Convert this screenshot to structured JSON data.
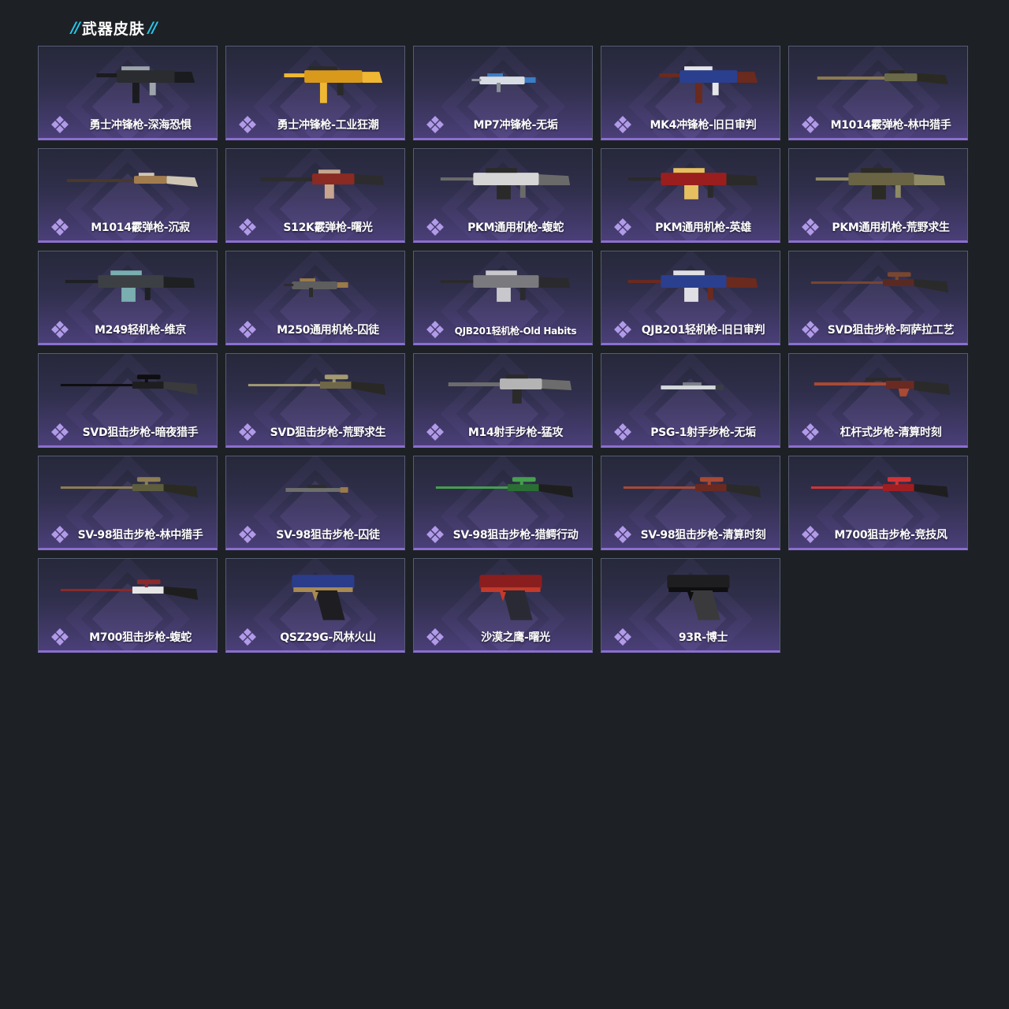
{
  "header": {
    "title": "武器皮肤",
    "slash": "//"
  },
  "skins": [
    {
      "name": "勇士冲锋枪-深海恐惧",
      "kind": "smg",
      "colors": [
        "#2a2c30",
        "#9ea4ab",
        "#1a1b1e"
      ]
    },
    {
      "name": "勇士冲锋枪-工业狂潮",
      "kind": "smg",
      "colors": [
        "#d99a1c",
        "#2a2a2a",
        "#f0b832"
      ]
    },
    {
      "name": "MP7冲锋枪-无垢",
      "kind": "compact",
      "colors": [
        "#d8dde4",
        "#3a7fc6",
        "#8a9098"
      ]
    },
    {
      "name": "MK4冲锋枪-旧日审判",
      "kind": "smg",
      "colors": [
        "#2a3f8e",
        "#e6e6ea",
        "#6a2a1e"
      ]
    },
    {
      "name": "M1014霰弹枪-林中猎手",
      "kind": "long",
      "colors": [
        "#6a6a48",
        "#2a2a22",
        "#8b7b52"
      ]
    },
    {
      "name": "M1014霰弹枪-沉寂",
      "kind": "long",
      "colors": [
        "#a37c4e",
        "#cfc7b4",
        "#4a3828"
      ]
    },
    {
      "name": "S12K霰弹枪-曙光",
      "kind": "rifle",
      "colors": [
        "#8a2a22",
        "#c7a58e",
        "#2c2c2e"
      ]
    },
    {
      "name": "PKM通用机枪-蝮蛇",
      "kind": "mg",
      "colors": [
        "#d6d6d6",
        "#2a2a2a",
        "#6a6a6a"
      ]
    },
    {
      "name": "PKM通用机枪-英雄",
      "kind": "mg",
      "colors": [
        "#9a1e1e",
        "#e6c060",
        "#2a2a2a"
      ]
    },
    {
      "name": "PKM通用机枪-荒野求生",
      "kind": "mg",
      "colors": [
        "#6a6444",
        "#2c2a24",
        "#8e8a66"
      ]
    },
    {
      "name": "M249轻机枪-维京",
      "kind": "mg",
      "colors": [
        "#3c4044",
        "#7aaeb0",
        "#1e2022"
      ]
    },
    {
      "name": "M250通用机枪-囚徒",
      "kind": "compact",
      "colors": [
        "#5e5e5e",
        "#9a7a4a",
        "#2c2c2c"
      ]
    },
    {
      "name": "QJB201轻机枪-Old Habits",
      "kind": "mg",
      "colors": [
        "#7a7a7e",
        "#c8c8cc",
        "#2a2a2e"
      ]
    },
    {
      "name": "QJB201轻机枪-旧日审判",
      "kind": "mg",
      "colors": [
        "#2a3f8e",
        "#e0e0e4",
        "#6a2a1e"
      ]
    },
    {
      "name": "SVD狙击步枪-阿萨拉工艺",
      "kind": "sniper",
      "colors": [
        "#5a2a22",
        "#2a2a2a",
        "#7a4630"
      ]
    },
    {
      "name": "SVD狙击步枪-暗夜猎手",
      "kind": "sniper",
      "colors": [
        "#1e1e20",
        "#3a3a3c",
        "#0e0e10"
      ]
    },
    {
      "name": "SVD狙击步枪-荒野求生",
      "kind": "sniper",
      "colors": [
        "#6e6848",
        "#2a2824",
        "#a29a72"
      ]
    },
    {
      "name": "M14射手步枪-猛攻",
      "kind": "rifle",
      "colors": [
        "#b4b4b4",
        "#2a2a2a",
        "#6c6c6c"
      ]
    },
    {
      "name": "PSG-1射手步枪-无垢",
      "kind": "thin",
      "colors": [
        "#d4d8dc",
        "#7a8088",
        "#3a3e44"
      ]
    },
    {
      "name": "杠杆式步枪-清算时刻",
      "kind": "lever",
      "colors": [
        "#6a2a22",
        "#2a2a2a",
        "#a84a34"
      ]
    },
    {
      "name": "SV-98狙击步枪-林中猎手",
      "kind": "sniper",
      "colors": [
        "#5e5e3e",
        "#2a2a22",
        "#8e7e54"
      ]
    },
    {
      "name": "SV-98狙击步枪-囚徒",
      "kind": "thin",
      "colors": [
        "#6e6e6e",
        "#2c2c2c",
        "#9a7a4a"
      ]
    },
    {
      "name": "SV-98狙击步枪-猎鳄行动",
      "kind": "sniper",
      "colors": [
        "#2a6e34",
        "#1e1e1e",
        "#46a04e"
      ]
    },
    {
      "name": "SV-98狙击步枪-清算时刻",
      "kind": "sniper",
      "colors": [
        "#6a2a22",
        "#2a2a2a",
        "#a84a34"
      ]
    },
    {
      "name": "M700狙击步枪-竞技风",
      "kind": "sniper",
      "colors": [
        "#a01e22",
        "#1e1e20",
        "#d43434"
      ]
    },
    {
      "name": "M700狙击步枪-蝮蛇",
      "kind": "sniper",
      "colors": [
        "#e6e6e6",
        "#1e1e1e",
        "#8a2a2a"
      ]
    },
    {
      "name": "QSZ29G-风林火山",
      "kind": "pistol",
      "colors": [
        "#2a3c8a",
        "#1e1e22",
        "#a88a52"
      ]
    },
    {
      "name": "沙漠之鹰-曙光",
      "kind": "pistol",
      "colors": [
        "#8a1e1e",
        "#2a2a34",
        "#c43a2a"
      ]
    },
    {
      "name": "93R-博士",
      "kind": "pistol",
      "colors": [
        "#1e1e20",
        "#3a3a3c",
        "#0e0e10"
      ]
    }
  ]
}
